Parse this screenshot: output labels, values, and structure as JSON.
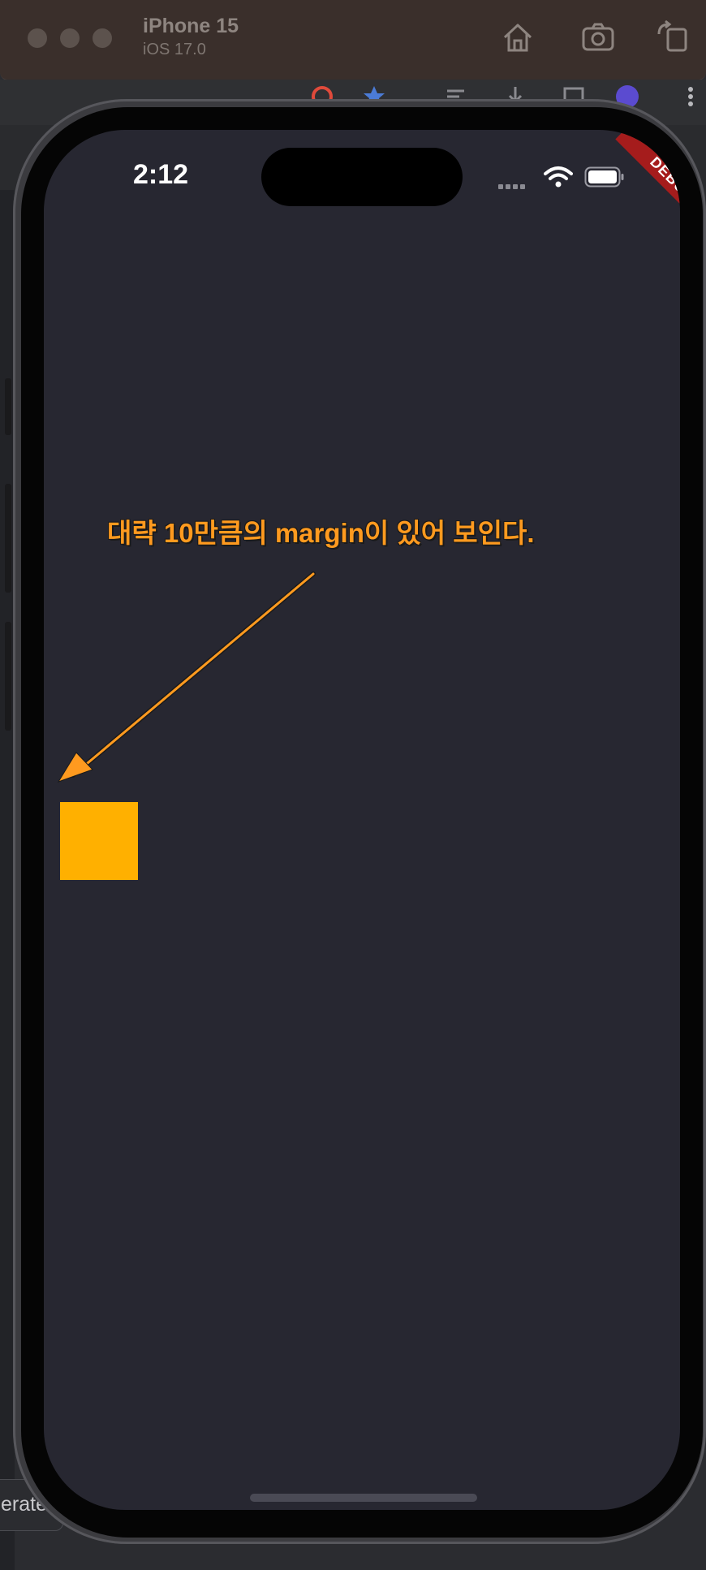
{
  "simulator": {
    "device_name": "iPhone 15",
    "os_version": "iOS 17.0",
    "toolbar_icons": [
      "home-icon",
      "camera-icon",
      "rotate-icon"
    ]
  },
  "background": {
    "button_partial_label": "erate"
  },
  "status_bar": {
    "time": "2:12"
  },
  "debug_banner": {
    "label": "DEBUG",
    "color": "#a51c1c"
  },
  "annotation": {
    "text": "대략 10만큼의 margin이 있어 보인다.",
    "color": "#ff9a1f"
  },
  "box": {
    "color": "#ffb000"
  },
  "screen": {
    "background": "#272731"
  }
}
